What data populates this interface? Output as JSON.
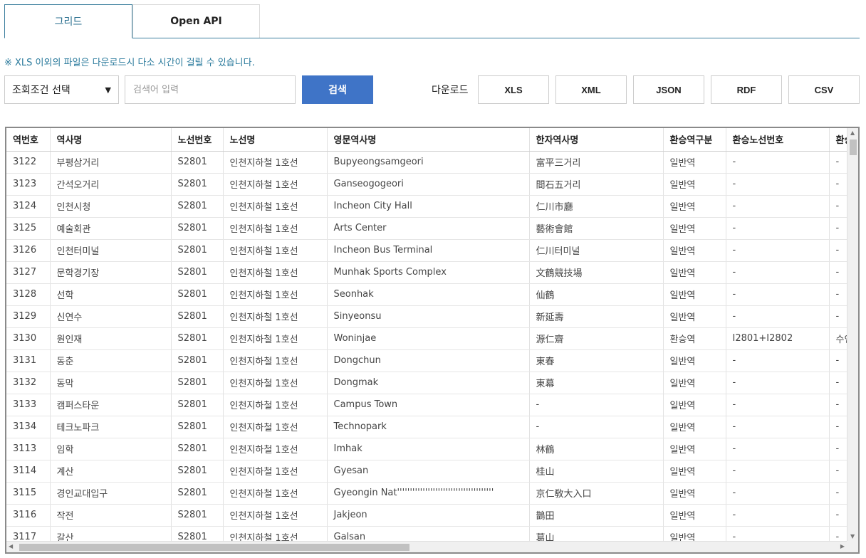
{
  "tabs": [
    {
      "label": "그리드",
      "active": true
    },
    {
      "label": "Open API",
      "active": false
    }
  ],
  "notice": "※ XLS 이외의 파일은 다운로드시 다소 시간이 걸릴 수 있습니다.",
  "search": {
    "condition_selected": "조회조건 선택",
    "placeholder": "검색어 입력",
    "button_label": "검색"
  },
  "download": {
    "label": "다운로드",
    "formats": [
      "XLS",
      "XML",
      "JSON",
      "RDF",
      "CSV"
    ]
  },
  "grid": {
    "columns": [
      "역번호",
      "역사명",
      "노선번호",
      "노선명",
      "영문역사명",
      "한자역사명",
      "환승역구분",
      "환승노선번호",
      "환승"
    ],
    "rows": [
      [
        "3122",
        "부평삼거리",
        "S2801",
        "인천지하철 1호선",
        "Bupyeongsamgeori",
        "富平三거리",
        "일반역",
        "-",
        "-"
      ],
      [
        "3123",
        "간석오거리",
        "S2801",
        "인천지하철 1호선",
        "Ganseogogeori",
        "間石五거리",
        "일반역",
        "-",
        "-"
      ],
      [
        "3124",
        "인천시청",
        "S2801",
        "인천지하철 1호선",
        "Incheon City Hall",
        "仁川市廳",
        "일반역",
        "-",
        "-"
      ],
      [
        "3125",
        "예술회관",
        "S2801",
        "인천지하철 1호선",
        "Arts Center",
        "藝術會館",
        "일반역",
        "-",
        "-"
      ],
      [
        "3126",
        "인천터미널",
        "S2801",
        "인천지하철 1호선",
        "Incheon Bus Terminal",
        "仁川터미널",
        "일반역",
        "-",
        "-"
      ],
      [
        "3127",
        "문학경기장",
        "S2801",
        "인천지하철 1호선",
        "Munhak Sports Complex",
        "文鶴競技場",
        "일반역",
        "-",
        "-"
      ],
      [
        "3128",
        "선학",
        "S2801",
        "인천지하철 1호선",
        "Seonhak",
        "仙鶴",
        "일반역",
        "-",
        "-"
      ],
      [
        "3129",
        "신연수",
        "S2801",
        "인천지하철 1호선",
        "Sinyeonsu",
        "新延壽",
        "일반역",
        "-",
        "-"
      ],
      [
        "3130",
        "원인재",
        "S2801",
        "인천지하철 1호선",
        "Woninjae",
        "源仁齋",
        "환승역",
        "I2801+I2802",
        "수인"
      ],
      [
        "3131",
        "동춘",
        "S2801",
        "인천지하철 1호선",
        "Dongchun",
        "東春",
        "일반역",
        "-",
        "-"
      ],
      [
        "3132",
        "동막",
        "S2801",
        "인천지하철 1호선",
        "Dongmak",
        "東幕",
        "일반역",
        "-",
        "-"
      ],
      [
        "3133",
        "캠퍼스타운",
        "S2801",
        "인천지하철 1호선",
        "Campus Town",
        "-",
        "일반역",
        "-",
        "-"
      ],
      [
        "3134",
        "테크노파크",
        "S2801",
        "인천지하철 1호선",
        "Technopark",
        "-",
        "일반역",
        "-",
        "-"
      ],
      [
        "3113",
        "임학",
        "S2801",
        "인천지하철 1호선",
        "Imhak",
        "林鶴",
        "일반역",
        "-",
        "-"
      ],
      [
        "3114",
        "계산",
        "S2801",
        "인천지하철 1호선",
        "Gyesan",
        "桂山",
        "일반역",
        "-",
        "-"
      ],
      [
        "3115",
        "경인교대입구",
        "S2801",
        "인천지하철 1호선",
        "Gyeongin Nat''''''''''''''''''''''''''''''''''''''",
        "京仁敎大入口",
        "일반역",
        "-",
        "-"
      ],
      [
        "3116",
        "작전",
        "S2801",
        "인천지하철 1호선",
        "Jakjeon",
        "鵲田",
        "일반역",
        "-",
        "-"
      ],
      [
        "3117",
        "갈산",
        "S2801",
        "인천지하철 1호선",
        "Galsan",
        "葛山",
        "일반역",
        "-",
        "-"
      ]
    ]
  }
}
